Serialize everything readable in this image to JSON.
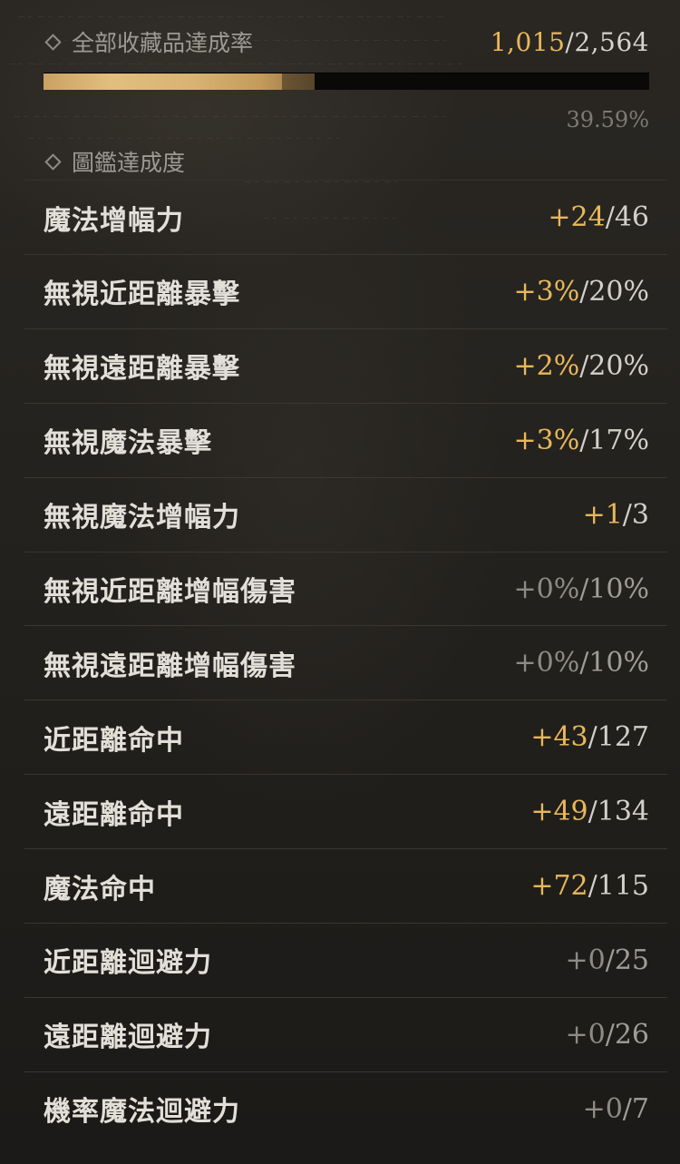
{
  "collection_summary": {
    "label": "全部收藏品達成率",
    "current": "1,015",
    "total": "/2,564",
    "percent_text": "39.59%",
    "progress_fraction": 0.3959
  },
  "section": {
    "title": "圖鑑達成度"
  },
  "stats": [
    {
      "name": "魔法增幅力",
      "gain": "+24",
      "max": "/46",
      "active": true
    },
    {
      "name": "無視近距離暴擊",
      "gain": "+3%",
      "max": "/20%",
      "active": true
    },
    {
      "name": "無視遠距離暴擊",
      "gain": "+2%",
      "max": "/20%",
      "active": true
    },
    {
      "name": "無視魔法暴擊",
      "gain": "+3%",
      "max": "/17%",
      "active": true
    },
    {
      "name": "無視魔法增幅力",
      "gain": "+1",
      "max": "/3",
      "active": true
    },
    {
      "name": "無視近距離增幅傷害",
      "gain": "+0%",
      "max": "/10%",
      "active": false
    },
    {
      "name": "無視遠距離增幅傷害",
      "gain": "+0%",
      "max": "/10%",
      "active": false
    },
    {
      "name": "近距離命中",
      "gain": "+43",
      "max": "/127",
      "active": true
    },
    {
      "name": "遠距離命中",
      "gain": "+49",
      "max": "/134",
      "active": true
    },
    {
      "name": "魔法命中",
      "gain": "+72",
      "max": "/115",
      "active": true
    },
    {
      "name": "近距離迴避力",
      "gain": "+0",
      "max": "/25",
      "active": false
    },
    {
      "name": "遠距離迴避力",
      "gain": "+0",
      "max": "/26",
      "active": false
    },
    {
      "name": "機率魔法迴避力",
      "gain": "+0",
      "max": "/7",
      "active": false
    }
  ],
  "colors": {
    "highlight_gold": "#e8b85a",
    "text_main": "#e2dfd8",
    "text_muted": "#9d9a94",
    "background": "#24221e"
  },
  "icons": {
    "bullet": "diamond-outline-icon"
  }
}
